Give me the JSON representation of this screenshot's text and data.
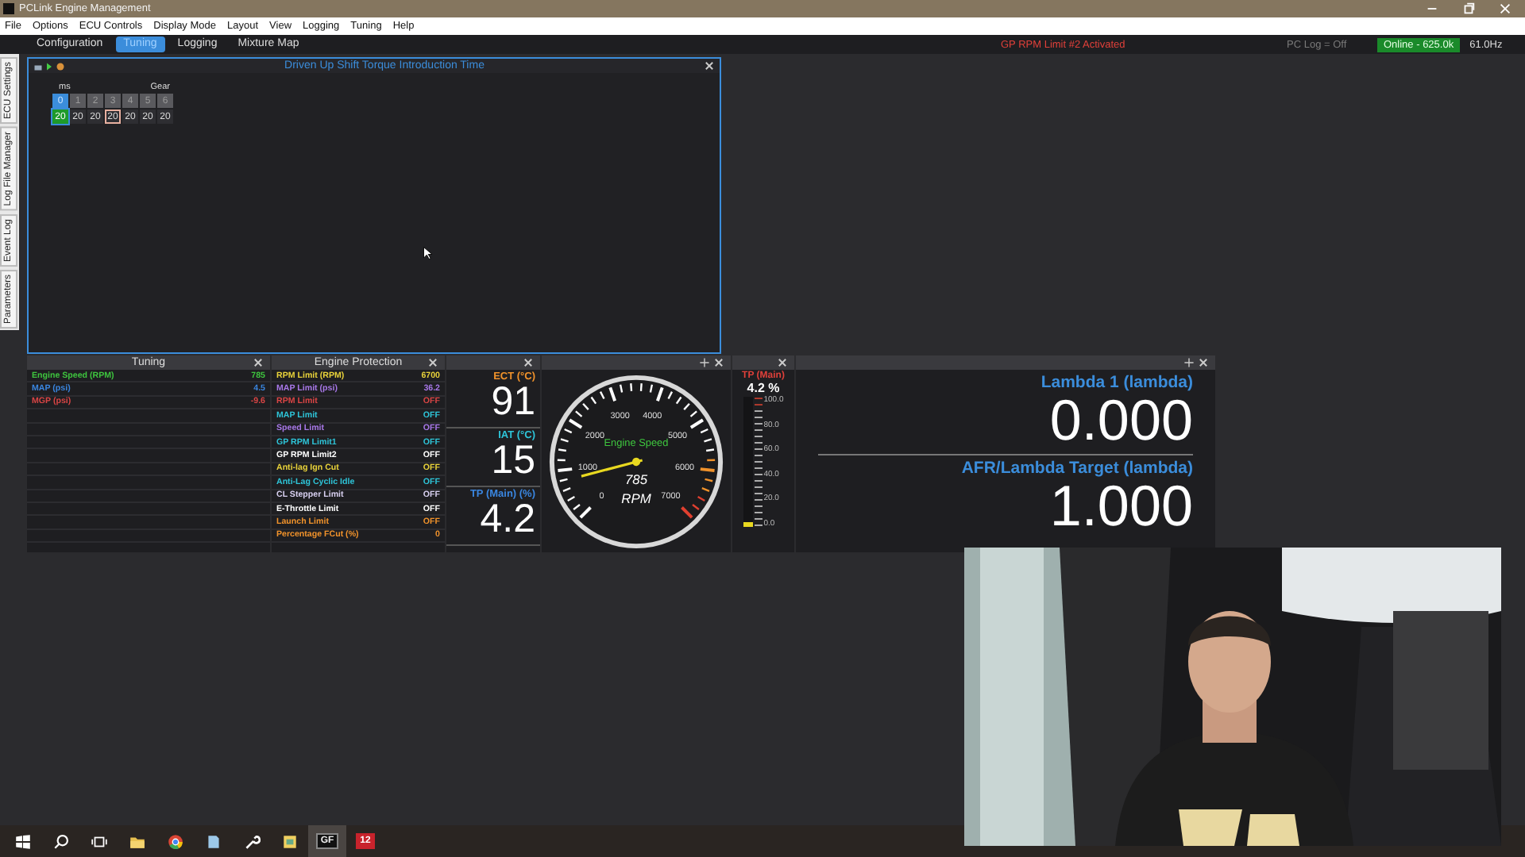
{
  "window": {
    "title": "PCLink Engine Management"
  },
  "menu": [
    "File",
    "Options",
    "ECU Controls",
    "Display Mode",
    "Layout",
    "View",
    "Logging",
    "Tuning",
    "Help"
  ],
  "tabs": [
    {
      "label": "Configuration",
      "selected": false
    },
    {
      "label": "Tuning",
      "selected": true
    },
    {
      "label": "Logging",
      "selected": false
    },
    {
      "label": "Mixture Map",
      "selected": false
    }
  ],
  "status": {
    "alert": "GP RPM Limit #2 Activated",
    "pc_log": "PC Log = Off",
    "connection": "Online - 625.0k",
    "rate": "61.0Hz"
  },
  "side_tabs": [
    "ECU Settings",
    "Log File Manager",
    "Event Log",
    "Parameters"
  ],
  "table_window": {
    "title": "Driven Up Shift Torque Introduction Time",
    "row_label": "ms",
    "column_label": "Gear",
    "columns": [
      {
        "label": "0",
        "selected": true
      },
      {
        "label": "1",
        "selected": false
      },
      {
        "label": "2",
        "selected": false
      },
      {
        "label": "3",
        "selected": false
      },
      {
        "label": "4",
        "selected": false
      },
      {
        "label": "5",
        "selected": false
      },
      {
        "label": "6",
        "selected": false
      }
    ],
    "cells": [
      {
        "value": "20",
        "live": true,
        "selected": false
      },
      {
        "value": "20",
        "live": false,
        "selected": false
      },
      {
        "value": "20",
        "live": false,
        "selected": false
      },
      {
        "value": "20",
        "live": false,
        "selected": true
      },
      {
        "value": "20",
        "live": false,
        "selected": false
      },
      {
        "value": "20",
        "live": false,
        "selected": false
      },
      {
        "value": "20",
        "live": false,
        "selected": false
      }
    ]
  },
  "tuning_panel": {
    "title": "Tuning",
    "rows": [
      {
        "name": "Engine Speed (RPM)",
        "value": "785",
        "color": "#3ec43e"
      },
      {
        "name": "MAP (psi)",
        "value": "4.5",
        "color": "#3a86e0"
      },
      {
        "name": "MGP (psi)",
        "value": "-9.6",
        "color": "#d94545"
      }
    ]
  },
  "protection_panel": {
    "title": "Engine Protection",
    "rows": [
      {
        "name": "RPM Limit (RPM)",
        "value": "6700",
        "color": "#e8d23a"
      },
      {
        "name": "MAP Limit (psi)",
        "value": "36.2",
        "color": "#a878e8"
      },
      {
        "name": "RPM Limit",
        "value": "OFF",
        "color": "#d94545"
      },
      {
        "name": "MAP Limit",
        "value": "OFF",
        "color": "#2ec4d8"
      },
      {
        "name": "Speed Limit",
        "value": "OFF",
        "color": "#a878e8"
      },
      {
        "name": "GP RPM Limit1",
        "value": "OFF",
        "color": "#2ec4d8"
      },
      {
        "name": "GP RPM Limit2",
        "value": "OFF",
        "color": "#ffffff"
      },
      {
        "name": "Anti-lag Ign Cut",
        "value": "OFF",
        "color": "#e8d23a"
      },
      {
        "name": "Anti-Lag Cyclic Idle",
        "value": "OFF",
        "color": "#2ec4d8"
      },
      {
        "name": "CL Stepper Limit",
        "value": "OFF",
        "color": "#d8d0f0"
      },
      {
        "name": "E-Throttle Limit",
        "value": "OFF",
        "color": "#ffffff"
      },
      {
        "name": "Launch Limit",
        "value": "OFF",
        "color": "#f0922b"
      },
      {
        "name": "Percentage FCut (%)",
        "value": "0",
        "color": "#f0922b"
      }
    ]
  },
  "numeric_panel": {
    "items": [
      {
        "label": "ECT (°C)",
        "value": "91",
        "color": "#f0922b"
      },
      {
        "label": "IAT (°C)",
        "value": "15",
        "color": "#2ec4d8"
      },
      {
        "label": "TP (Main) (%)",
        "value": "4.2",
        "color": "#3a86e0"
      }
    ]
  },
  "gauge": {
    "title": "Engine Speed",
    "reading": "785",
    "unit": "RPM",
    "scale": [
      "0",
      "1000",
      "2000",
      "3000",
      "4000",
      "5000",
      "6000",
      "7000"
    ]
  },
  "bar_meter": {
    "title": "TP (Main)",
    "reading": "4.2 %",
    "scale": [
      "100.0",
      "80.0",
      "60.0",
      "40.0",
      "20.0",
      "0.0"
    ],
    "level": 0.042
  },
  "lambda_panel": {
    "items": [
      {
        "label": "Lambda 1 (lambda)",
        "value": "0.000"
      },
      {
        "label": "AFR/Lambda Target (lambda)",
        "value": "1.000"
      }
    ]
  },
  "video": {
    "kind": "picture"
  },
  "taskbar": [
    {
      "kind": "start",
      "selected": false
    },
    {
      "kind": "search",
      "selected": false
    },
    {
      "kind": "taskview",
      "selected": false
    },
    {
      "kind": "folder",
      "selected": false
    },
    {
      "kind": "browser",
      "selected": false
    },
    {
      "kind": "document",
      "selected": false
    },
    {
      "kind": "wrench",
      "selected": false
    },
    {
      "kind": "notes",
      "selected": false
    },
    {
      "kind": "app",
      "label": "GF",
      "selected": true
    },
    {
      "kind": "app",
      "label": "12",
      "selected": false
    }
  ]
}
